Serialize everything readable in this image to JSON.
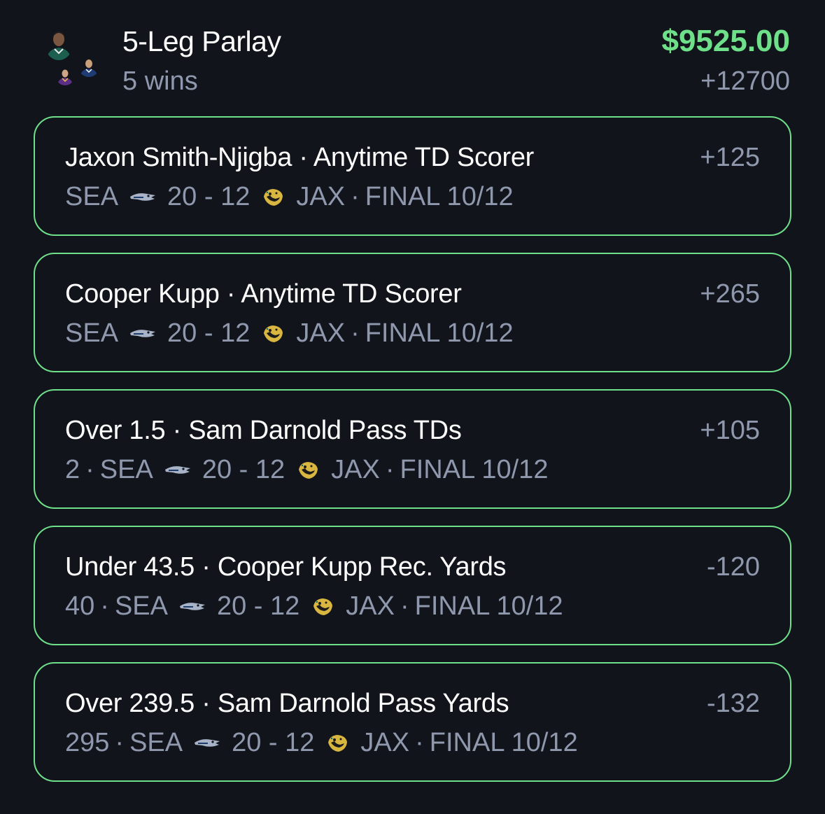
{
  "header": {
    "title": "5-Leg Parlay",
    "subtitle": "5 wins",
    "payout": "$9525.00",
    "odds": "+12700"
  },
  "legs": [
    {
      "title": "Jaxon Smith-Njigba · Anytime TD Scorer",
      "odds": "+125",
      "stat": "",
      "home": "SEA",
      "score": "20 - 12",
      "away": "JAX",
      "status": "FINAL 10/12"
    },
    {
      "title": "Cooper Kupp · Anytime TD Scorer",
      "odds": "+265",
      "stat": "",
      "home": "SEA",
      "score": "20 - 12",
      "away": "JAX",
      "status": "FINAL 10/12"
    },
    {
      "title": "Over 1.5 · Sam Darnold Pass TDs",
      "odds": "+105",
      "stat": "2",
      "home": "SEA",
      "score": "20 - 12",
      "away": "JAX",
      "status": "FINAL 10/12"
    },
    {
      "title": "Under 43.5 · Cooper Kupp Rec. Yards",
      "odds": "-120",
      "stat": "40",
      "home": "SEA",
      "score": "20 - 12",
      "away": "JAX",
      "status": "FINAL 10/12"
    },
    {
      "title": "Over 239.5 · Sam Darnold Pass Yards",
      "odds": "-132",
      "stat": "295",
      "home": "SEA",
      "score": "20 - 12",
      "away": "JAX",
      "status": "FINAL 10/12"
    }
  ],
  "icons": {
    "home_logo": "seahawks-logo-icon",
    "away_logo": "jaguars-logo-icon",
    "avatars": [
      "player-avatar-icon",
      "player-avatar-icon",
      "player-avatar-icon"
    ]
  },
  "colors": {
    "background": "#11141b",
    "win_accent": "#6ee08a",
    "muted_text": "#8f98ad",
    "primary_text": "#ffffff"
  }
}
